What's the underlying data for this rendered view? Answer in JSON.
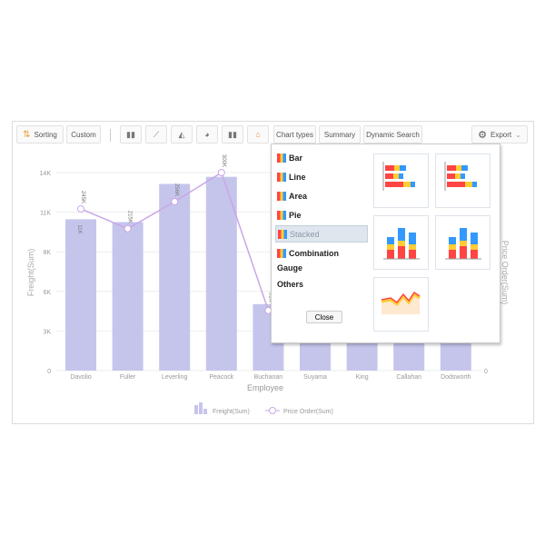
{
  "toolbar": {
    "sorting": "Sorting",
    "custom": "Custom",
    "chart_types": "Chart types",
    "summary": "Summary",
    "dynamic_search": "Dynamic Search",
    "export": "Export",
    "icon_buttons": [
      "bar-chart-icon",
      "line-chart-icon",
      "area-chart-icon",
      "pie-chart-icon",
      "stacked-chart-icon",
      "combination-chart-icon"
    ]
  },
  "popup": {
    "items": [
      {
        "label": "Bar",
        "icon": "bar-icon"
      },
      {
        "label": "Line",
        "icon": "line-icon"
      },
      {
        "label": "Area",
        "icon": "area-icon"
      },
      {
        "label": "Pie",
        "icon": "pie-icon"
      },
      {
        "label": "Stacked",
        "icon": "stacked-icon",
        "selected": true
      },
      {
        "label": "Combination",
        "icon": "combination-icon"
      },
      {
        "label": "Gauge"
      },
      {
        "label": "Others"
      }
    ],
    "close": "Close",
    "thumbnails": [
      "stacked-horizontal-bar",
      "stacked-horizontal-bar-3d",
      "stacked-column",
      "stacked-column-3d",
      "stacked-area"
    ]
  },
  "chart_data": {
    "type": "bar",
    "xlabel": "Employee",
    "ylabel": "Freight(Sum)",
    "y2label": "Price Order(Sum)",
    "categories": [
      "Davolio",
      "Fuller",
      "Leverling",
      "Peacock",
      "Buchanan",
      "Suyama",
      "King",
      "Callahan",
      "Dodsworth"
    ],
    "yticks": [
      "0",
      "3K",
      "6K",
      "8K",
      "11K",
      "14K"
    ],
    "ylim": [
      0,
      14000
    ],
    "y2ticks": [
      "0"
    ],
    "y2lim": [
      0,
      300000
    ],
    "series": [
      {
        "name": "Freight(Sum)",
        "type": "bar",
        "color": "#c5c5ec",
        "values": [
          10700,
          10500,
          13200,
          13700,
          4700,
          4000,
          4000,
          4000,
          4000
        ],
        "labels": [
          "11K",
          "",
          "",
          "",
          "",
          "",
          "",
          "",
          ""
        ]
      },
      {
        "name": "Price Order(Sum)",
        "type": "line",
        "color": "#c9a6e6",
        "values": [
          245000,
          215000,
          256000,
          300000,
          91000
        ],
        "labels": [
          "245K",
          "215K",
          "256K",
          "300K",
          "91K"
        ]
      }
    ],
    "legend": "bottom"
  }
}
